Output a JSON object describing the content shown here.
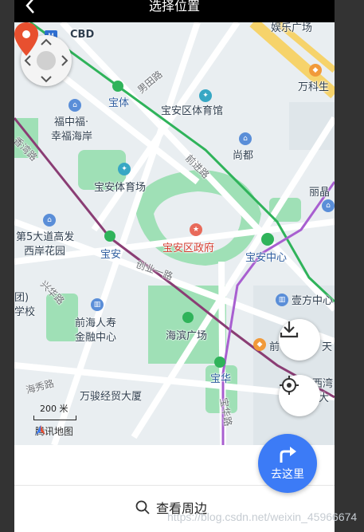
{
  "header": {
    "title": "选择位置"
  },
  "map": {
    "labels": {
      "yule": "娱乐广场",
      "cbd": "CBD",
      "wanke": "万科生",
      "nanhua": "男田路",
      "baoti": "宝体",
      "tiyuguan": "宝安区体育馆",
      "fuzhong": "福中福·",
      "xingfu": "幸福海岸",
      "shangdu": "尚都",
      "road_xiang": "香湾路",
      "road_qian": "前进路",
      "tiyuchang": "宝安体育场",
      "lijia": "丽晶",
      "fifth1": "第5大道高发",
      "fifth2": "西岸花园",
      "baoan": "宝安",
      "gov": "宝安区政府",
      "zhongxin": "宝安中心",
      "chuangye": "创业一路",
      "road_xingfu": "兴华路",
      "tuan": "团)",
      "xiao": "学校",
      "haishou1": "前海人寿",
      "haishou2": "金融中心",
      "guangchang": "海滨广场",
      "yihe": "壹方中心",
      "qian": "前",
      "tian": "天",
      "haixiu": "海秀路",
      "baohua": "宝华",
      "xixiang": "西湾",
      "da": "大",
      "wanjun": "万骏经贸大厦",
      "road_baohua": "宝华路",
      "road_gong": "公"
    },
    "scale": "200 米",
    "logo": "腾讯地图"
  },
  "bottom": {
    "go_label": "去这里",
    "nearby_label": "查看周边"
  },
  "watermark": "https://blog.csdn.net/weixin_45966674",
  "colors": {
    "accent": "#3c7bf6",
    "pin": "#e8502f",
    "metro_green": "#2fb35a",
    "metro_purple": "#8a3d74"
  }
}
